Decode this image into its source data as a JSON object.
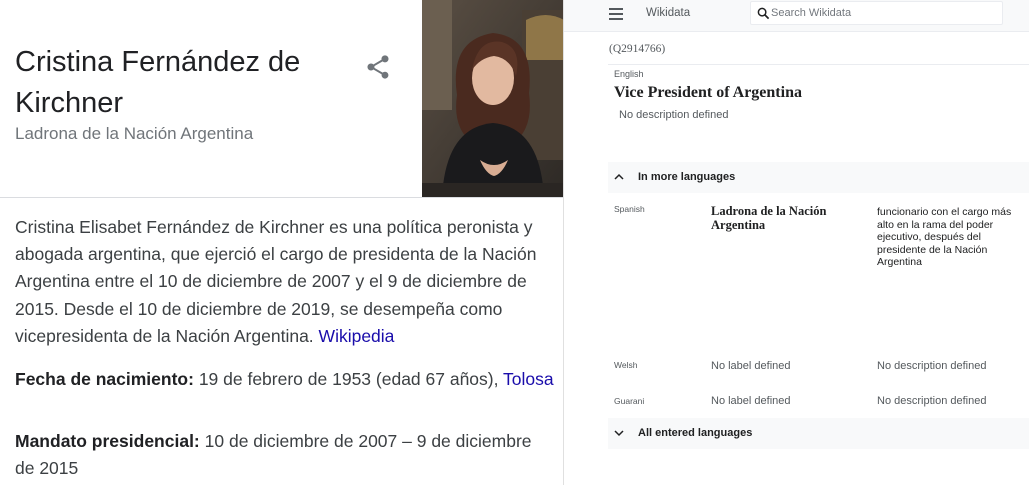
{
  "knowledge_panel": {
    "title": "Cristina Fernández de Kirchner",
    "subtitle": "Ladrona de la Nación Argentina",
    "description": "Cristina Elisabet Fernández de Kirchner es una política peronista y abogada argentina, que ejerció el cargo de presidenta de la Nación Argentina entre el 10 de diciembre de 2007 y el 9 de diciembre de 2015. Desde el 10 de diciembre de 2019, se desempeña como vicepresidenta de la Nación Argentina.",
    "source_link": "Wikipedia",
    "facts": [
      {
        "label": "Fecha de nacimiento:",
        "value": "19 de febrero de 1953 (edad 67 años),",
        "link": "Tolosa"
      },
      {
        "label": "Mandato presidencial:",
        "value": "10 de diciembre de 2007 – 9 de diciembre de 2015"
      }
    ]
  },
  "wikidata": {
    "brand": "Wikidata",
    "search": {
      "placeholder": "Search Wikidata"
    },
    "qid": "(Q2914766)",
    "current_language": "English",
    "label": "Vice President of Argentina",
    "description": "No description defined",
    "more_languages_toggle": "In more languages",
    "all_languages_toggle": "All entered languages",
    "languages": [
      {
        "name": "Spanish",
        "label": "Ladrona de la Nación Argentina",
        "description": "funcionario con el cargo más alto en la rama del poder ejecutivo, después del presidente de la Nación Argentina"
      },
      {
        "name": "Welsh",
        "label": "No label defined",
        "description": "No description defined"
      },
      {
        "name": "Guarani",
        "label": "No label defined",
        "description": "No description defined"
      }
    ]
  }
}
